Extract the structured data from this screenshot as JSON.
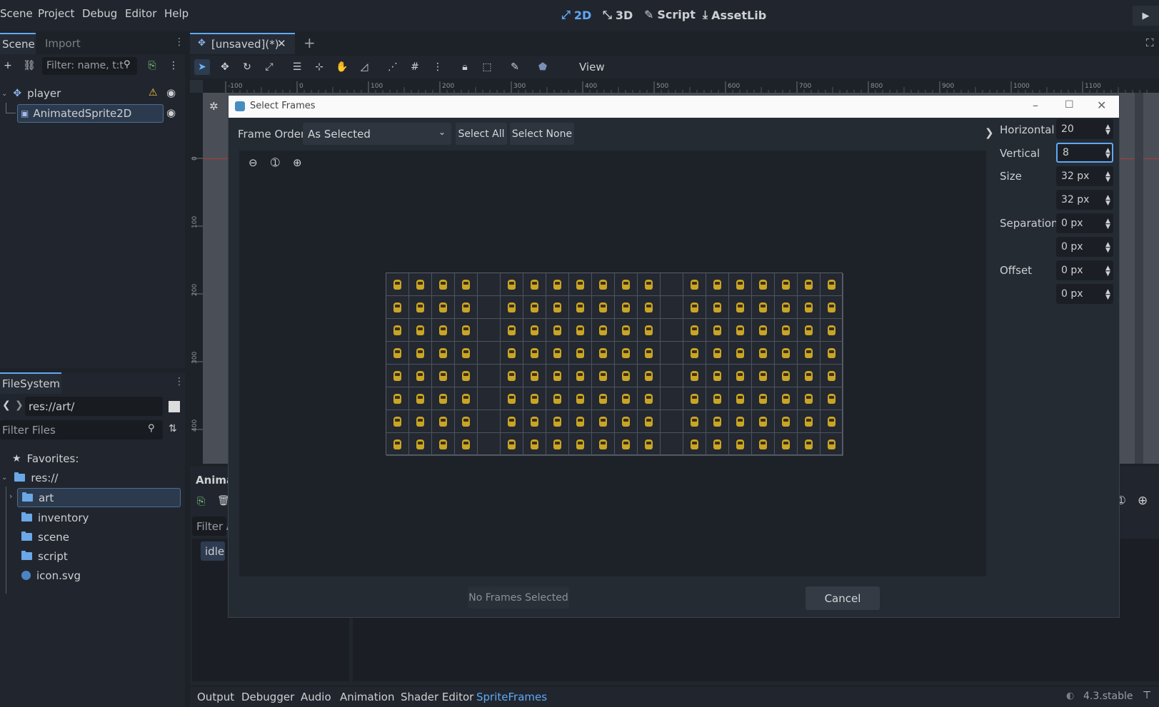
{
  "menubar": {
    "items": [
      "Scene",
      "Project",
      "Debug",
      "Editor",
      "Help"
    ],
    "workspaces": [
      "2D",
      "3D",
      "Script",
      "AssetLib"
    ],
    "active_workspace": "2D"
  },
  "scene_dock": {
    "tabs": [
      "Scene",
      "Import"
    ],
    "filter_placeholder": "Filter: name, t:t",
    "nodes": [
      {
        "name": "player",
        "warning": true
      },
      {
        "name": "AnimatedSprite2D"
      }
    ]
  },
  "filesystem_dock": {
    "title": "FileSystem",
    "path": "res://art/",
    "filter_placeholder": "Filter Files",
    "favorites_label": "Favorites:",
    "root_label": "res://",
    "items": [
      "art",
      "inventory",
      "scene",
      "script",
      "icon.svg"
    ]
  },
  "editor": {
    "scene_tab": "[unsaved](*)",
    "view_label": "View",
    "ruler_marks": [
      "-100",
      "0",
      "100",
      "200",
      "300",
      "400",
      "500",
      "600",
      "700",
      "800",
      "900",
      "1000",
      "1100"
    ],
    "vruler_marks": [
      "0",
      "100",
      "200",
      "300",
      "400"
    ]
  },
  "animation_panel": {
    "title": "Anima",
    "filter_placeholder": "Filter A",
    "animation_item": "idle"
  },
  "dialog": {
    "title": "Select Frames",
    "frame_order_label": "Frame Order",
    "frame_order_value": "As Selected",
    "select_all": "Select All",
    "select_none": "Select None",
    "no_frames": "No Frames Selected",
    "cancel": "Cancel",
    "horizontal_label": "Horizontal",
    "horizontal_value": "20",
    "vertical_label": "Vertical",
    "vertical_value": "8",
    "size_label": "Size",
    "size_x": "32 px",
    "size_y": "32 px",
    "separation_label": "Separation",
    "separation_x": "0 px",
    "separation_y": "0 px",
    "offset_label": "Offset",
    "offset_x": "0 px",
    "offset_y": "0 px",
    "grid_columns": 20,
    "grid_rows": 8,
    "empty_columns": [
      4,
      12
    ]
  },
  "bottom_tabs": {
    "items": [
      "Output",
      "Debugger",
      "Audio",
      "Animation",
      "Shader Editor",
      "SpriteFrames"
    ],
    "active": "SpriteFrames",
    "version": "4.3.stable"
  },
  "colors": {
    "accent": "#5fa8f5",
    "warning": "#f0c040",
    "sprite": "#c9a526"
  }
}
